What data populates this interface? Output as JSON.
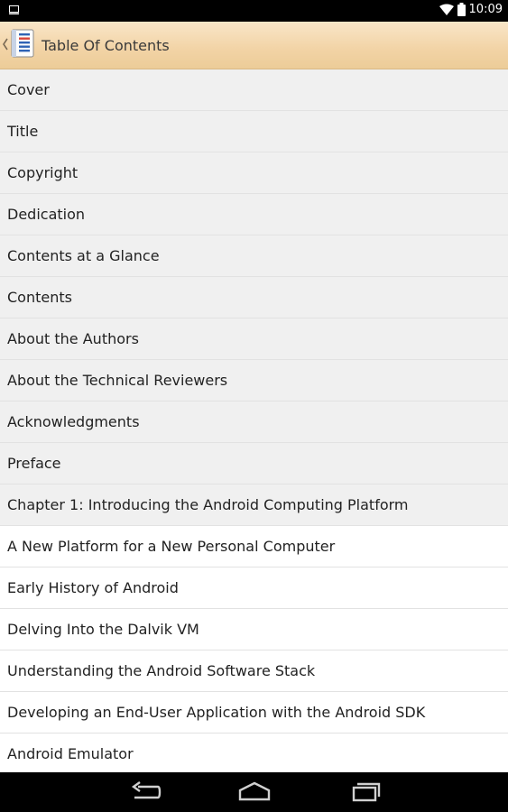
{
  "status_bar": {
    "time": "10:09",
    "left_icon": "screen-icon",
    "right_icons": [
      "wifi-icon",
      "battery-icon"
    ]
  },
  "action_bar": {
    "title": "Table Of Contents",
    "icon": "book-icon"
  },
  "toc": {
    "items": [
      {
        "label": "Cover",
        "style": "grey"
      },
      {
        "label": "Title",
        "style": "grey"
      },
      {
        "label": "Copyright",
        "style": "grey"
      },
      {
        "label": "Dedication",
        "style": "grey"
      },
      {
        "label": "Contents at a Glance",
        "style": "grey"
      },
      {
        "label": "Contents",
        "style": "grey"
      },
      {
        "label": "About the Authors",
        "style": "grey"
      },
      {
        "label": "About the Technical Reviewers",
        "style": "grey"
      },
      {
        "label": "Acknowledgments",
        "style": "grey"
      },
      {
        "label": "Preface",
        "style": "grey"
      },
      {
        "label": "Chapter 1: Introducing the Android Computing Platform",
        "style": "grey"
      },
      {
        "label": "A New Platform for a New Personal Computer",
        "style": "white"
      },
      {
        "label": "Early History of Android",
        "style": "white"
      },
      {
        "label": "Delving Into the Dalvik VM",
        "style": "white"
      },
      {
        "label": "Understanding the Android Software Stack",
        "style": "white"
      },
      {
        "label": "Developing an End-User Application with the Android SDK",
        "style": "white"
      },
      {
        "label": "Android Emulator",
        "style": "white"
      }
    ]
  },
  "nav_bar": {
    "buttons": [
      "back-icon",
      "home-icon",
      "recent-apps-icon"
    ]
  }
}
